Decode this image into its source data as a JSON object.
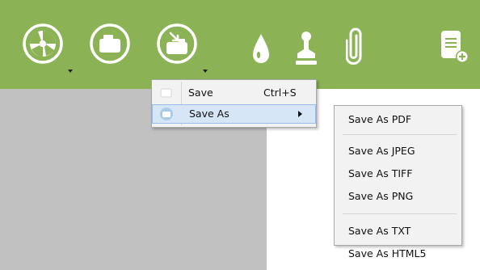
{
  "colors": {
    "toolbar_bg": "#8bb255",
    "canvas_gray": "#c1c1c1",
    "menu_bg": "#f2f2f2",
    "highlight": "#d7e6f7"
  },
  "toolbar": {
    "buttons": [
      {
        "icon": "aperture-icon",
        "has_dropdown": true
      },
      {
        "icon": "open-folder-icon",
        "has_dropdown": false
      },
      {
        "icon": "save-icon",
        "has_dropdown": true
      },
      {
        "icon": "drop-icon",
        "has_dropdown": false
      },
      {
        "icon": "stamp-icon",
        "has_dropdown": false
      },
      {
        "icon": "paperclip-icon",
        "has_dropdown": false
      },
      {
        "icon": "add-document-icon",
        "has_dropdown": false
      }
    ]
  },
  "save_menu": {
    "items": [
      {
        "label": "Save",
        "shortcut": "Ctrl+S"
      },
      {
        "label": "Save As",
        "has_submenu": true
      }
    ]
  },
  "save_as_menu": {
    "items": [
      "Save As PDF",
      "Save As JPEG",
      "Save As TIFF",
      "Save As PNG",
      "Save As TXT",
      "Save As HTML5"
    ]
  }
}
